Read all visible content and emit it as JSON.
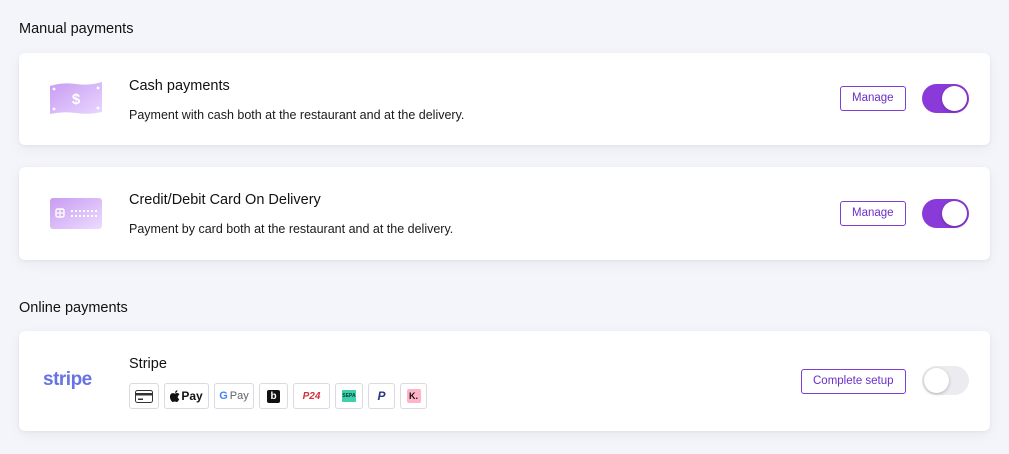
{
  "sections": {
    "manual": {
      "title": "Manual payments"
    },
    "online": {
      "title": "Online payments"
    }
  },
  "cash": {
    "title": "Cash payments",
    "description": "Payment with cash both at the restaurant and at the delivery.",
    "manage_label": "Manage",
    "enabled": true,
    "icon": "cash-dollar-icon",
    "icon_text": "$"
  },
  "card_on_delivery": {
    "title": "Credit/Debit Card On Delivery",
    "description": "Payment by card both at the restaurant and at the delivery.",
    "manage_label": "Manage",
    "enabled": true,
    "icon": "credit-card-icon"
  },
  "stripe": {
    "logo_text": "stripe",
    "title": "Stripe",
    "setup_label": "Complete setup",
    "enabled": false,
    "methods": {
      "card": "card-icon",
      "apple_pay": {
        "text": "Pay",
        "icon": "apple-pay-icon"
      },
      "google_pay": {
        "g": "G",
        "text": "Pay",
        "icon": "google-pay-icon"
      },
      "bancontact": {
        "text": "b",
        "icon": "bancontact-icon"
      },
      "p24": {
        "text": "P24",
        "icon": "przelewy24-icon"
      },
      "sepa": {
        "text": "SEPA",
        "icon": "sepa-icon"
      },
      "paypal": {
        "text": "P",
        "icon": "paypal-icon"
      },
      "klarna": {
        "text": "K.",
        "icon": "klarna-icon"
      }
    }
  },
  "colors": {
    "accent": "#8a3ad8",
    "accent_border": "#7b3fd6",
    "stripe_brand": "#6772e5",
    "background": "#f4f5fa"
  }
}
